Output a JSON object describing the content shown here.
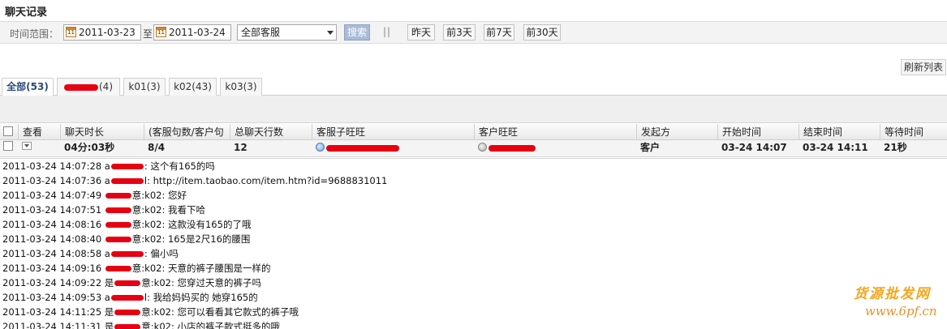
{
  "page": {
    "title": "聊天记录"
  },
  "filter": {
    "range_label": "时间范围：",
    "start_date": "2011-03-23",
    "to_label": "至",
    "end_date": "2011-03-24",
    "agent_select": "全部客服",
    "search_label": "搜索",
    "separator": "||",
    "quick_ranges": [
      "昨天",
      "前3天",
      "前7天",
      "前30天"
    ]
  },
  "refresh_label": "刷新列表",
  "tabs": [
    {
      "label": "全部(53)",
      "active": true
    },
    {
      "label": "(4)",
      "redacted": true
    },
    {
      "label": "k01(3)"
    },
    {
      "label": "k02(43)"
    },
    {
      "label": "k03(3)"
    }
  ],
  "table": {
    "columns": [
      "查看",
      "聊天时长",
      "(客服句数/客户句",
      "总聊天行数",
      "客服子旺旺",
      "客户旺旺",
      "发起方",
      "开始时间",
      "结束时间",
      "等待时间"
    ],
    "row": {
      "duration": "04分:03秒",
      "sentences": "8/4",
      "total_lines": "12",
      "initiator": "客户",
      "start_time": "03-24 14:07",
      "end_time": "03-24 14:11",
      "wait_time": "21秒"
    }
  },
  "log": [
    {
      "ts": "2011-03-24 14:07:28",
      "prefix": "a",
      "suffix": "",
      "text": ": 这个有165的吗"
    },
    {
      "ts": "2011-03-24 14:07:36",
      "prefix": "a",
      "suffix": "l",
      "text": ": http://item.taobao.com/item.htm?id=9688831011"
    },
    {
      "ts": "2011-03-24 14:07:49",
      "prefix": "",
      "suffix": "意",
      "text": ":k02: 您好"
    },
    {
      "ts": "2011-03-24 14:07:51",
      "prefix": "",
      "suffix": "意",
      "text": ":k02: 我看下哈"
    },
    {
      "ts": "2011-03-24 14:08:16",
      "prefix": "",
      "suffix": "意",
      "text": ":k02: 这款没有165的了哦"
    },
    {
      "ts": "2011-03-24 14:08:40",
      "prefix": "",
      "suffix": "意",
      "text": ":k02: 165是2尺16的腰围"
    },
    {
      "ts": "2011-03-24 14:08:58",
      "prefix": "a",
      "suffix": "",
      "text": ": 偏小吗"
    },
    {
      "ts": "2011-03-24 14:09:16",
      "prefix": "",
      "suffix": "意",
      "text": ":k02: 天意的裤子腰围是一样的"
    },
    {
      "ts": "2011-03-24 14:09:22",
      "prefix": "是",
      "suffix": "意",
      "text": ":k02: 您穿过天意的裤子吗"
    },
    {
      "ts": "2011-03-24 14:09:53",
      "prefix": "a",
      "suffix": "l",
      "text": ": 我给妈妈买的 她穿165的"
    },
    {
      "ts": "2011-03-24 14:11:25",
      "prefix": "是",
      "suffix": "意",
      "text": ":k02: 您可以看看其它款式的裤子哦"
    },
    {
      "ts": "2011-03-24 14:11:31",
      "prefix": "是",
      "suffix": "意",
      "text": ":k02: 小店的裤子款式挺多的哦"
    }
  ],
  "watermark": {
    "top": "货源批发网",
    "bottom": "www.6pf.cn"
  },
  "colors": {
    "redaction": "#e60012",
    "search_button": "#a9bbd6",
    "watermark": "#f5a51d"
  }
}
